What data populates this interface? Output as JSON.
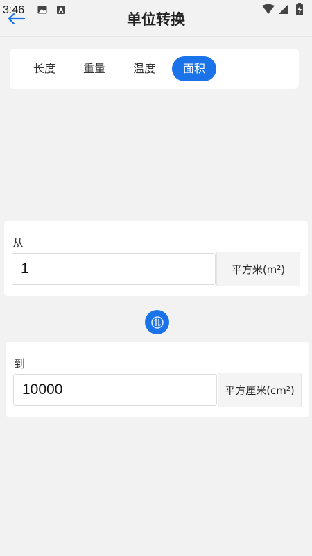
{
  "status_bar": {
    "time": "3:46",
    "icons": [
      "gallery-icon",
      "a-notification-icon",
      "wifi-icon",
      "signal-icon",
      "battery-charging-icon"
    ]
  },
  "header": {
    "title": "单位转换",
    "back_icon": "back-arrow-icon"
  },
  "tabs": [
    {
      "label": "长度",
      "active": false
    },
    {
      "label": "重量",
      "active": false
    },
    {
      "label": "温度",
      "active": false
    },
    {
      "label": "面积",
      "active": true
    }
  ],
  "from": {
    "label": "从",
    "value": "1",
    "unit": "平方米(m²)"
  },
  "to": {
    "label": "到",
    "value": "10000",
    "unit": "平方厘米(cm²)"
  },
  "swap_icon": "swap-vertical-icon",
  "colors": {
    "accent": "#1a73e8",
    "background": "#f2f2f2",
    "card": "#ffffff"
  }
}
